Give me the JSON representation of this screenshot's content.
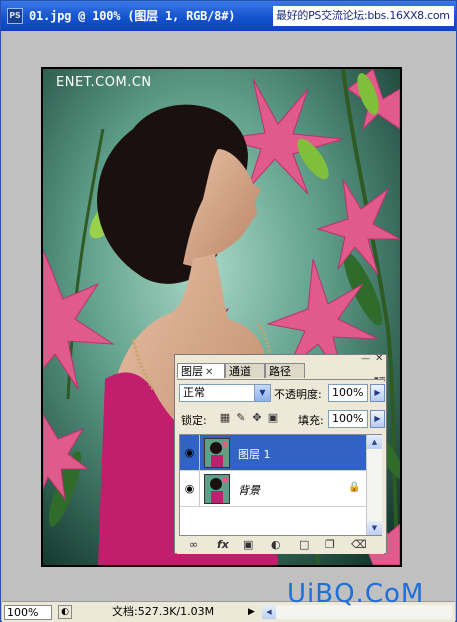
{
  "window": {
    "title": "01.jpg @ 100% (图层 1, RGB/8#)",
    "app_icon": "PS"
  },
  "watermark_top": "最好的PS交流论坛:bbs.16XX8.com",
  "photo": {
    "caption": "ENET.COM.CN"
  },
  "layers_panel": {
    "tabs": [
      {
        "label": "图层",
        "active": true
      },
      {
        "label": "通道",
        "active": false
      },
      {
        "label": "路径",
        "active": false
      }
    ],
    "blend_mode": "正常",
    "opacity_label": "不透明度:",
    "opacity_value": "100%",
    "lock_label": "锁定:",
    "fill_label": "填充:",
    "fill_value": "100%",
    "layers": [
      {
        "name": "图层 1",
        "visible": true,
        "selected": true,
        "locked": false
      },
      {
        "name": "背景",
        "visible": true,
        "selected": false,
        "locked": true
      }
    ],
    "footer_icons": [
      "link-icon",
      "fx-icon",
      "mask-icon",
      "adjustment-icon",
      "group-folder-icon",
      "new-layer-icon",
      "trash-icon"
    ],
    "footer_fx": "fx"
  },
  "statusbar": {
    "zoom": "100%",
    "doc_info": "文档:527.3K/1.03M"
  },
  "watermark_bottom": "UiBQ.CoM",
  "colors": {
    "titlebar": "#1553cf",
    "selected_layer": "#3163c5",
    "canvas_bg": "#c0c0c0",
    "watermark_blue": "#1f6fd8"
  }
}
